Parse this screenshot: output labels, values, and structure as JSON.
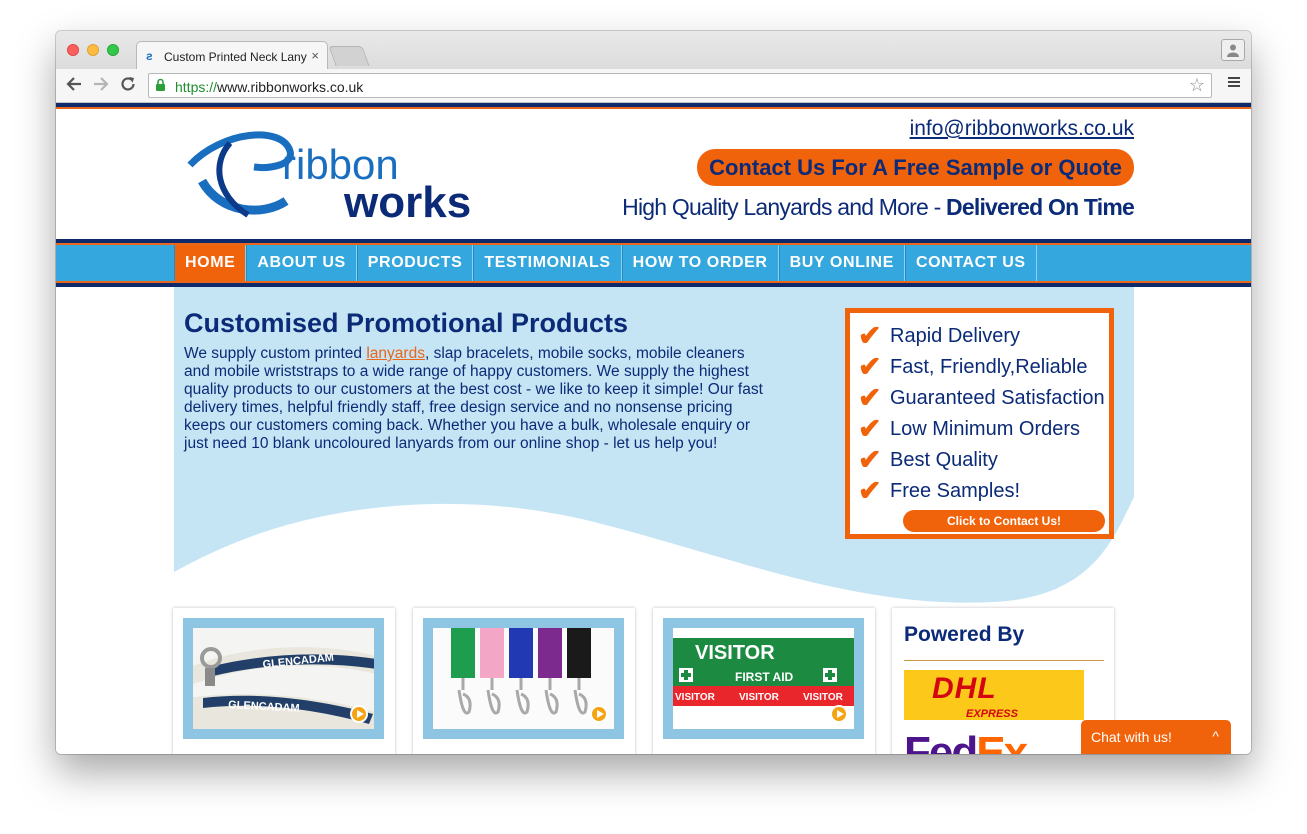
{
  "browser": {
    "tab_title": "Custom Printed Neck Lany",
    "tab_close": "×",
    "url_scheme": "https://",
    "url_rest": "www.ribbonworks.co.uk"
  },
  "header": {
    "logo_text_top": "ribbon",
    "logo_text_bottom": "works",
    "email": "info@ribbonworks.co.uk",
    "cta": "Contact Us For A Free Sample or Quote",
    "tagline_regular": "High Quality Lanyards and More - ",
    "tagline_bold": "Delivered On Time"
  },
  "nav": {
    "items": [
      {
        "label": "HOME"
      },
      {
        "label": "ABOUT US"
      },
      {
        "label": "PRODUCTS"
      },
      {
        "label": "TESTIMONIALS"
      },
      {
        "label": "HOW TO ORDER"
      },
      {
        "label": "BUY ONLINE"
      },
      {
        "label": "CONTACT US"
      }
    ],
    "active": "HOME"
  },
  "hero": {
    "title": "Customised Promotional Products",
    "text_before": "We supply custom printed ",
    "link": "lanyards",
    "text_after": ", slap bracelets, mobile socks, mobile cleaners and mobile wriststraps to a wide range of happy customers. We supply the highest quality products to our customers at the best cost - we like to keep it simple! Our fast delivery times, helpful friendly staff, free design service and no nonsense pricing keeps our customers coming back. Whether you have a bulk, wholesale enquiry or just need 10 blank uncoloured lanyards from our online shop - let us help you!"
  },
  "benefits": {
    "items": [
      {
        "label": "Rapid Delivery"
      },
      {
        "label": "Fast, Friendly,Reliable"
      },
      {
        "label": "Guaranteed Satisfaction"
      },
      {
        "label": "Low Minimum Orders"
      },
      {
        "label": "Best Quality"
      },
      {
        "label": "Free Samples!"
      }
    ],
    "button": "Click to Contact Us!"
  },
  "cards": {
    "glencadam_text": "GLENCADAM",
    "glencadam_text2": "GLENCADAM",
    "visitor_text": "VISITOR",
    "first_aid_text": "FIRST AID",
    "visitor_small_1": "VISITOR",
    "visitor_small_2": "VISITOR",
    "visitor_small_3": "VISITOR"
  },
  "powered": {
    "title": "Powered By",
    "dhl": "DHL",
    "dhl_express": "EXPRESS",
    "fedex_a": "Fed",
    "fedex_b": "Ex"
  },
  "chat": {
    "label": "Chat with us!",
    "caret": "^"
  },
  "colors": {
    "brand_navy": "#0b2a77",
    "brand_orange": "#f1630a",
    "nav_blue": "#34a8de",
    "hero_bg": "#c6e5f4"
  }
}
